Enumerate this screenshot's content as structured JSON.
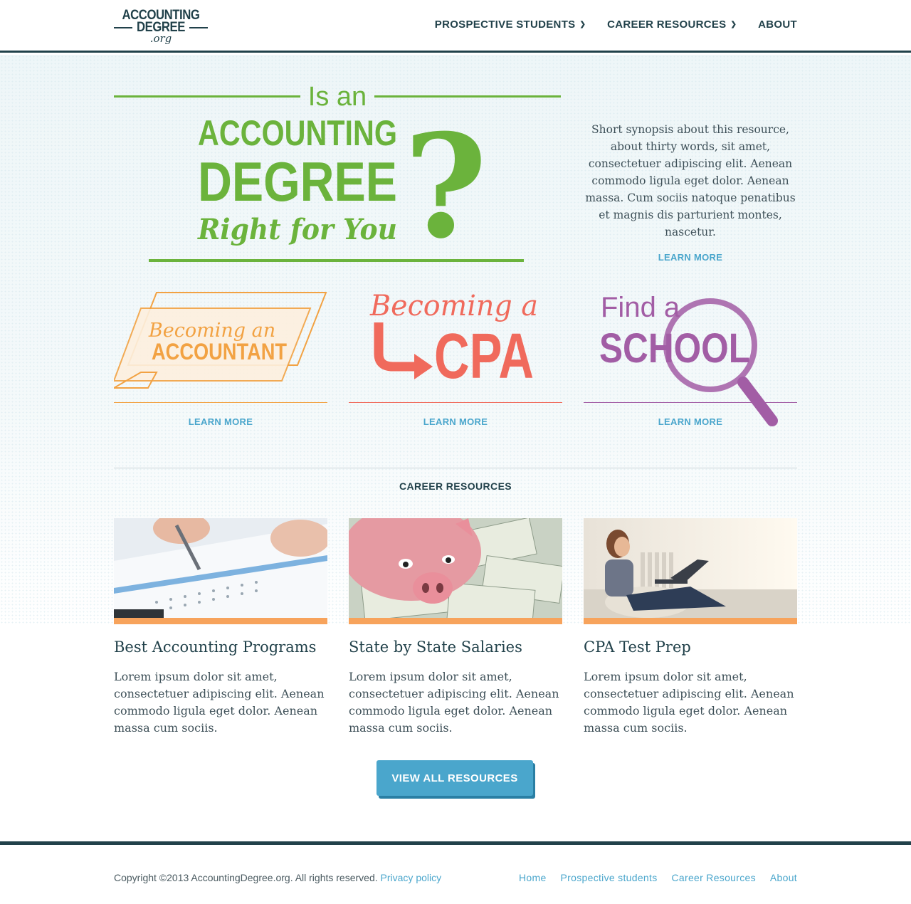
{
  "header": {
    "logo": {
      "line1": "ACCOUNTING",
      "line2": "DEGREE",
      "line3": ".org"
    },
    "nav": [
      {
        "label": "PROSPECTIVE STUDENTS",
        "icon": "chevron-down-icon"
      },
      {
        "label": "CAREER RESOURCES",
        "icon": "chevron-down-icon"
      },
      {
        "label": "ABOUT"
      }
    ]
  },
  "hero": {
    "title_top": "Is an",
    "title_main1": "ACCOUNTING",
    "title_main2": "DEGREE",
    "title_script": "Right for You",
    "title_mark": "?",
    "synopsis": "Short synopsis about this resource, about thirty words, sit amet, consectetuer adipiscing elit. Aenean commodo ligula eget dolor. Aenean massa. Cum sociis natoque penatibus et magnis dis parturient montes, nascetur.",
    "learn_more": "LEARN MORE",
    "color": "#6bb33c"
  },
  "features": [
    {
      "script": "Becoming an",
      "main": "ACCOUNTANT",
      "learn_more": "LEARN MORE",
      "color": "#f2a243"
    },
    {
      "script": "Becoming a",
      "main": "CPA",
      "learn_more": "LEARN MORE",
      "color": "#f06a5c"
    },
    {
      "script": "Find a",
      "main": "SCHOOL",
      "learn_more": "LEARN MORE",
      "color": "#a25da5"
    }
  ],
  "career_resources": {
    "title": "CAREER RESOURCES",
    "cards": [
      {
        "title": "Best Accounting Programs",
        "text": "Lorem ipsum dolor sit amet, consectetuer adipiscing elit. Aenean commodo ligula eget dolor. Aenean massa cum sociis."
      },
      {
        "title": "State by State Salaries",
        "text": "Lorem ipsum dolor sit amet, consectetuer adipiscing elit. Aenean commodo ligula eget dolor. Aenean massa cum sociis."
      },
      {
        "title": "CPA Test Prep",
        "text": "Lorem ipsum dolor sit amet, consectetuer adipiscing elit. Aenean commodo ligula eget dolor. Aenean massa cum sociis."
      }
    ],
    "button": "VIEW ALL RESOURCES",
    "accent": "#f7a35c",
    "button_color": "#4aa6cc"
  },
  "footer": {
    "copyright": "Copyright ©2013 AccountingDegree.org. All rights reserved.",
    "privacy": "Privacy policy",
    "links": [
      "Home",
      "Prospective students",
      "Career Resources",
      "About"
    ]
  }
}
